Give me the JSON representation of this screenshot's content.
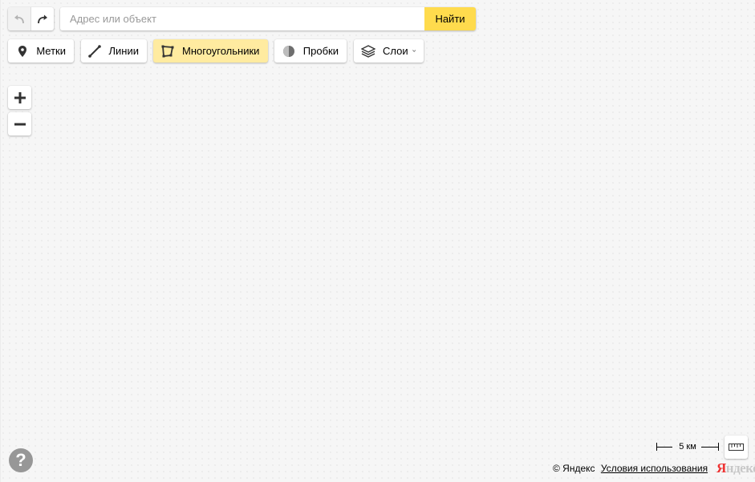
{
  "history": {
    "undo_icon": "undo-arrow-icon",
    "redo_icon": "redo-arrow-icon"
  },
  "search": {
    "placeholder": "Адрес или объект",
    "value": "",
    "button_label": "Найти"
  },
  "toolbar": {
    "marks": {
      "label": "Метки",
      "icon": "placemark-icon"
    },
    "lines": {
      "label": "Линии",
      "icon": "line-icon"
    },
    "polygons": {
      "label": "Многоугольники",
      "icon": "polygon-icon",
      "active": true
    },
    "traffic": {
      "label": "Пробки",
      "icon": "traffic-icon"
    },
    "layers": {
      "label": "Слои",
      "icon": "layers-icon"
    }
  },
  "zoom": {
    "in_icon": "plus-icon",
    "out_icon": "minus-icon"
  },
  "help": {
    "label": "?"
  },
  "scale": {
    "label": "5 км"
  },
  "ruler": {
    "icon": "ruler-icon"
  },
  "footer": {
    "copyright": "© Яндекс",
    "terms_link": "Условия использования",
    "logo_first": "Я",
    "logo_rest": "ндекс"
  },
  "colors": {
    "accent": "#ffdb4d",
    "active_tool": "#ffeba0",
    "logo_red": "#ee3333"
  }
}
